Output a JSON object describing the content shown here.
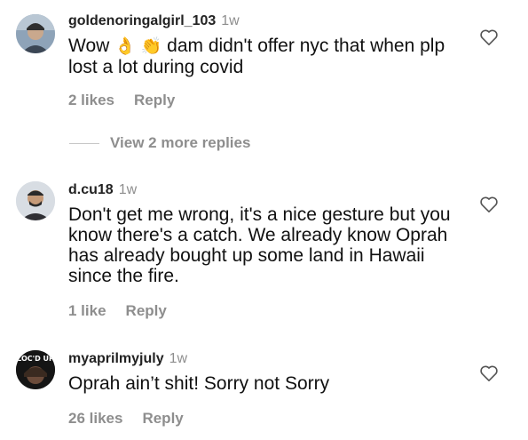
{
  "comments": [
    {
      "username": "goldenoringalgirl_103",
      "time": "1w",
      "text_parts": [
        "Wow ",
        "👌",
        " ",
        "👏",
        " dam didn't  offer nyc that when plp lost a lot during  covid"
      ],
      "likes": "2 likes",
      "reply": "Reply"
    },
    {
      "username": "d.cu18",
      "time": "1w",
      "text": "Don't get me wrong, it's a nice gesture but you know there's a catch. We already know Oprah has already bought up some land in Hawaii since the fire.",
      "likes": "1 like",
      "reply": "Reply"
    },
    {
      "username": "myaprilmyjuly",
      "time": "1w",
      "text": "Oprah ain’t shit! Sorry not Sorry",
      "likes": "26 likes",
      "reply": "Reply",
      "avatar_text": "LOC'D UP"
    }
  ],
  "view_more": "View 2 more replies",
  "colors": {
    "muted": "#8e8e8e",
    "divider": "#c7c7c7",
    "text": "#111111"
  }
}
